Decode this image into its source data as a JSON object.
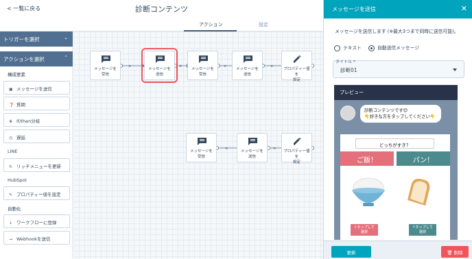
{
  "header": {
    "back_label": "< 一覧に戻る",
    "title": "診断コンテンツ",
    "tabs": [
      {
        "label": "アクション",
        "active": true
      },
      {
        "label": "設定",
        "active": false
      }
    ]
  },
  "sidebar": {
    "trigger_section": "トリガーを選択",
    "action_section": "アクションを選択",
    "categories": [
      "構成要素",
      "LINE",
      "HubSpot",
      "自動化"
    ],
    "items": [
      {
        "label": "メッセージを送信",
        "icon": "message-icon"
      },
      {
        "label": "質問",
        "icon": "question-icon"
      },
      {
        "label": "If/then分岐",
        "icon": "branch-icon"
      },
      {
        "label": "遅延",
        "icon": "clock-icon"
      },
      {
        "label": "リッチメニューを更新",
        "icon": "refresh-icon"
      },
      {
        "label": "プロパティー値を設定",
        "icon": "pencil-icon"
      },
      {
        "label": "ワークフローに登録",
        "icon": "arrow-down-icon"
      },
      {
        "label": "Webhookを送信",
        "icon": "webhook-icon"
      }
    ]
  },
  "canvas": {
    "row1": [
      {
        "label": "メッセージを受信",
        "icon": "message-icon"
      },
      {
        "label": "メッセージを送信",
        "icon": "message-icon"
      },
      {
        "label": "メッセージを受信",
        "icon": "message-icon"
      },
      {
        "label": "メッセージを送信",
        "icon": "message-icon"
      },
      {
        "label": "プロパティー値を設定",
        "icon": "pencil-icon"
      }
    ],
    "row2": [
      {
        "label": "メッセージを受信",
        "icon": "message-icon"
      },
      {
        "label": "メッセージを送信",
        "icon": "message-icon"
      },
      {
        "label": "プロパティー値を設定",
        "icon": "pencil-icon"
      }
    ],
    "highlight_color": "#f2545b"
  },
  "panel": {
    "title": "メッセージを送信",
    "description": "メッセージを送信します (※最大3つまで同時に送信可能)。",
    "radio_options": [
      {
        "label": "テキスト",
        "selected": false
      },
      {
        "label": "自動送信メッセージ",
        "selected": true
      }
    ],
    "field_label": "タイトル *",
    "field_value": "診断01",
    "preview": {
      "header": "プレビュー",
      "bubble_lines": [
        "診断コンテンツです😊",
        "👇好きな方をタップしてください👇"
      ],
      "card_title": "どっちがすき？",
      "choices": [
        {
          "label": "ご飯！",
          "button": "↑タップして選択",
          "color": "#e3707b",
          "button_color": "#e3707b"
        },
        {
          "label": "パン！",
          "button": "↑タップして選択",
          "color": "#4d8a8e",
          "button_color": "#4d8a8e"
        }
      ]
    },
    "update_button": "更新",
    "delete_button": "削除"
  },
  "colors": {
    "accent": "#00a4bd",
    "sidebar_section": "#516f90",
    "danger": "#f2545b"
  }
}
